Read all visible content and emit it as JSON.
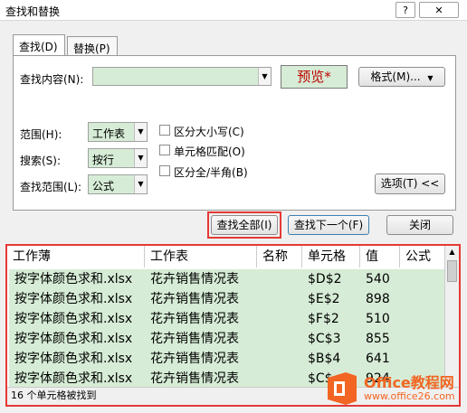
{
  "window": {
    "title": "查找和替换",
    "help_icon": "?",
    "close_icon": "✕"
  },
  "tabs": [
    {
      "label": "查找(D)"
    },
    {
      "label": "替换(P)"
    }
  ],
  "find": {
    "content_label": "查找内容(N):",
    "content_value": "",
    "preview": "预览*",
    "format_button": "格式(M)...",
    "options": {
      "within_label": "范围(H):",
      "within_value": "工作表",
      "search_label": "搜索(S):",
      "search_value": "按行",
      "lookin_label": "查找范围(L):",
      "lookin_value": "公式"
    },
    "checkboxes": [
      {
        "label": "区分大小写(C)"
      },
      {
        "label": "单元格匹配(O)"
      },
      {
        "label": "区分全/半角(B)"
      }
    ],
    "options_button": "选项(T) <<"
  },
  "buttons": {
    "find_all": "查找全部(I)",
    "find_next": "查找下一个(F)",
    "close": "关闭"
  },
  "results": {
    "columns": [
      "工作薄",
      "工作表",
      "名称",
      "单元格",
      "值",
      "公式"
    ],
    "rows": [
      [
        "按字体颜色求和.xlsx",
        "花卉销售情况表",
        "",
        "$D$2",
        "540",
        ""
      ],
      [
        "按字体颜色求和.xlsx",
        "花卉销售情况表",
        "",
        "$E$2",
        "898",
        ""
      ],
      [
        "按字体颜色求和.xlsx",
        "花卉销售情况表",
        "",
        "$F$2",
        "510",
        ""
      ],
      [
        "按字体颜色求和.xlsx",
        "花卉销售情况表",
        "",
        "$C$3",
        "855",
        ""
      ],
      [
        "按字体颜色求和.xlsx",
        "花卉销售情况表",
        "",
        "$B$4",
        "641",
        ""
      ],
      [
        "按字体颜色求和.xlsx",
        "花卉销售情况表",
        "",
        "$C$",
        "924",
        ""
      ]
    ],
    "status": "16 个单元格被找到"
  },
  "watermark": {
    "brand": "Office教程网",
    "url": "www.office26.com"
  },
  "colors": {
    "highlight_green": "#d6ecd6",
    "red_outline": "#e53935",
    "preview_text": "#c00000",
    "brand_orange": "#f26522"
  }
}
